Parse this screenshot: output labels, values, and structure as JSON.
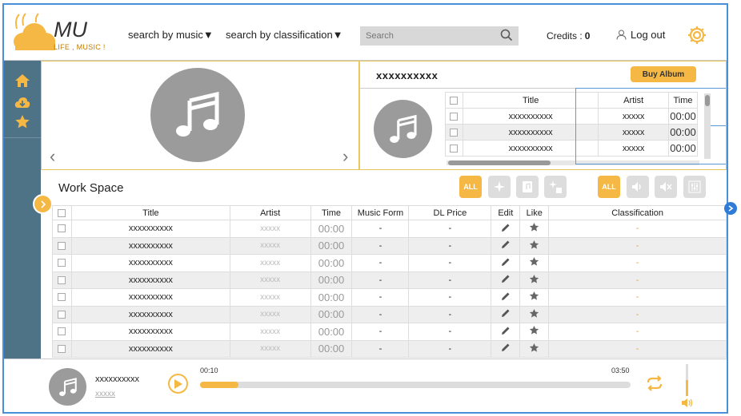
{
  "brand": {
    "name": "MU",
    "tagline": "LIFE , MUSIC !",
    "accent": "#f5b844"
  },
  "nav": {
    "search_music": "search by music▼",
    "search_class": "search by classification▼"
  },
  "search": {
    "placeholder": "Search"
  },
  "credits": {
    "label": "Credits :",
    "value": "0"
  },
  "logout": {
    "label": "Log out"
  },
  "sidebar": {
    "icons": [
      "home-icon",
      "cloud-download-icon",
      "star-icon"
    ]
  },
  "album": {
    "title": "xxxxxxxxxx",
    "buy_label": "Buy Album",
    "columns": [
      "Title",
      "Artist",
      "Time"
    ],
    "rows": [
      {
        "title": "xxxxxxxxxx",
        "artist": "xxxxx",
        "time": "00:00"
      },
      {
        "title": "xxxxxxxxxx",
        "artist": "xxxxx",
        "time": "00:00"
      },
      {
        "title": "xxxxxxxxxx",
        "artist": "xxxxx",
        "time": "00:00"
      }
    ]
  },
  "workspace": {
    "title": "Work Space",
    "filter_all": "ALL",
    "sound_all": "ALL",
    "columns": [
      "Title",
      "Artist",
      "Time",
      "Music Form",
      "DL Price",
      "Edit",
      "Like",
      "Classification"
    ],
    "rows": [
      {
        "title": "xxxxxxxxxx",
        "artist": "xxxxx",
        "time": "00:00",
        "form": "-",
        "price": "-",
        "cls": "-"
      },
      {
        "title": "xxxxxxxxxx",
        "artist": "xxxxx",
        "time": "00:00",
        "form": "-",
        "price": "-",
        "cls": "-"
      },
      {
        "title": "xxxxxxxxxx",
        "artist": "xxxxx",
        "time": "00:00",
        "form": "-",
        "price": "-",
        "cls": "-"
      },
      {
        "title": "xxxxxxxxxx",
        "artist": "xxxxx",
        "time": "00:00",
        "form": "-",
        "price": "-",
        "cls": "-"
      },
      {
        "title": "xxxxxxxxxx",
        "artist": "xxxxx",
        "time": "00:00",
        "form": "-",
        "price": "-",
        "cls": "-"
      },
      {
        "title": "xxxxxxxxxx",
        "artist": "xxxxx",
        "time": "00:00",
        "form": "-",
        "price": "-",
        "cls": "-"
      },
      {
        "title": "xxxxxxxxxx",
        "artist": "xxxxx",
        "time": "00:00",
        "form": "-",
        "price": "-",
        "cls": "-"
      },
      {
        "title": "xxxxxxxxxx",
        "artist": "xxxxx",
        "time": "00:00",
        "form": "-",
        "price": "-",
        "cls": "-"
      }
    ]
  },
  "player": {
    "title": "xxxxxxxxxx",
    "artist": "xxxxx",
    "elapsed": "00:10",
    "duration": "03:50",
    "progress": 0.09,
    "volume": 0.5
  }
}
